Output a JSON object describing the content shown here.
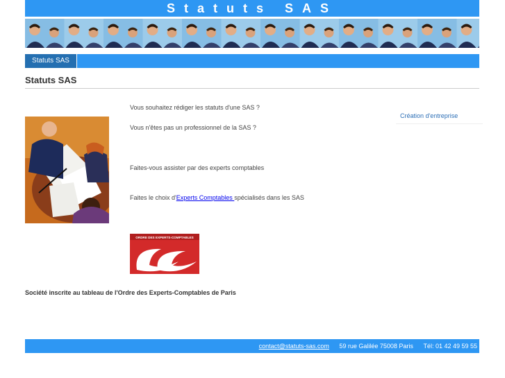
{
  "header": {
    "title": "Statuts SAS"
  },
  "nav": {
    "tabs": [
      {
        "label": "Statuts SAS"
      }
    ]
  },
  "main": {
    "title": "Statuts SAS",
    "paragraphs": {
      "p1": "Vous souhaitez rédiger les statuts d'une SAS ?",
      "p2": "Vous n'êtes pas un professionnel de la SAS ?",
      "p3": "Faites-vous assister par des experts comptables",
      "p4_before": "Faites le choix d'",
      "p4_link": "Experts Comptables ",
      "p4_after": "spécialisés dans les SAS"
    },
    "logo_text": "ORDRE DES EXPERTS-COMPTABLES",
    "registration": "Société inscrite au tableau de l'Ordre des Experts-Comptables de Paris"
  },
  "sidebar": {
    "link": "Création d'entreprise"
  },
  "footer": {
    "email": "contact@statuts-sas.com",
    "address": "59 rue Galilée 75008 Paris",
    "phone": "Tél: 01 42 49 59 55"
  },
  "colors": {
    "accent": "#2e97f3",
    "nav_active": "#246fb1",
    "logo_red": "#d32a2a"
  }
}
